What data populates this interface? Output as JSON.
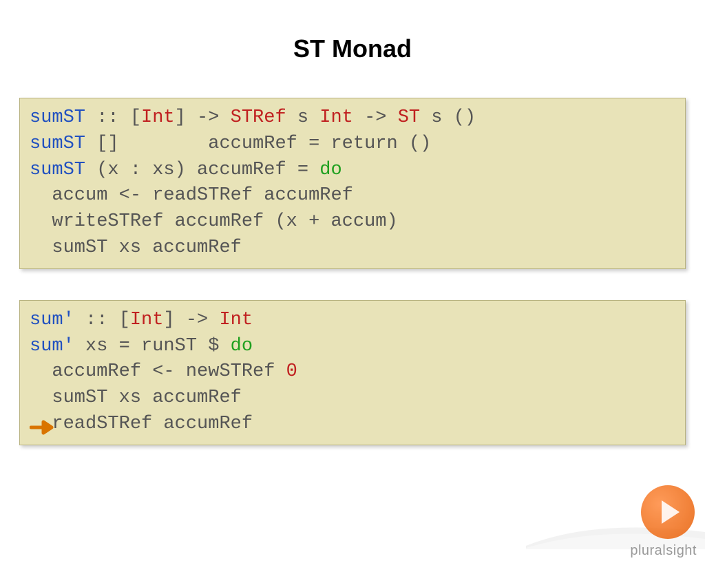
{
  "title": "ST Monad",
  "block1": {
    "l1": {
      "a": "sumST",
      "b": " :: [",
      "c": "Int",
      "d": "] -> ",
      "e": "STRef",
      "f": " s ",
      "g": "Int",
      "h": " -> ",
      "i": "ST",
      "j": " s ()"
    },
    "l2": {
      "a": "sumST",
      "b": " []        accumRef = return ()"
    },
    "l3": {
      "a": "sumST",
      "b": " (x : xs) accumRef = ",
      "c": "do"
    },
    "l4": "  accum <- readSTRef accumRef",
    "l5": "  writeSTRef accumRef (x + accum)",
    "l6": "  sumST xs accumRef"
  },
  "block2": {
    "l1": {
      "a": "sum'",
      "b": " :: [",
      "c": "Int",
      "d": "] -> ",
      "e": "Int"
    },
    "l2": {
      "a": "sum'",
      "b": " xs = runST $ ",
      "c": "do"
    },
    "l3": {
      "a": "  accumRef <- newSTRef ",
      "b": "0"
    },
    "l4": "  sumST xs accumRef",
    "l5": "  readSTRef accumRef"
  },
  "brand": "pluralsight"
}
